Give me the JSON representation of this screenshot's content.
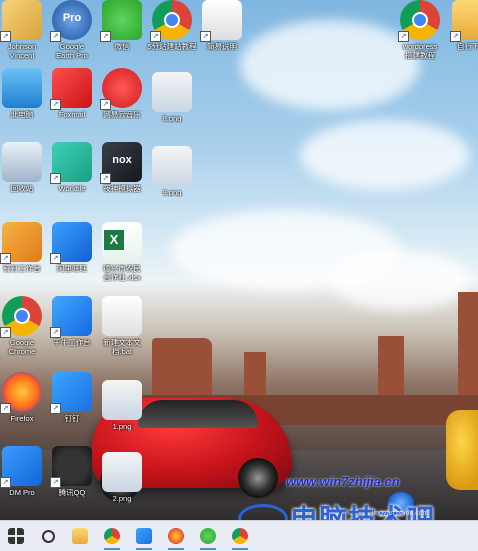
{
  "desktop": {
    "icons": [
      {
        "id": "johnson",
        "label": "Johnson\nVincent",
        "icon": "user-folder-icon"
      },
      {
        "id": "earth",
        "label": "Google\nEarth Pro",
        "icon": "google-earth-pro-icon",
        "badge": "Pro"
      },
      {
        "id": "wechat",
        "label": "微信",
        "icon": "wechat-icon"
      },
      {
        "id": "chrome-tutorial",
        "label": "5分站建站教程",
        "icon": "chrome-icon"
      },
      {
        "id": "doc1",
        "label": "简易说明",
        "icon": "document-icon"
      },
      {
        "id": "wordpress",
        "label": "wordpress\n搭建教程",
        "icon": "chrome-icon"
      },
      {
        "id": "rightfolder",
        "label": "自行下载",
        "icon": "folder-icon"
      },
      {
        "id": "thispc",
        "label": "此电脑",
        "icon": "computer-icon"
      },
      {
        "id": "foxmail",
        "label": "Foxmail",
        "icon": "foxmail-icon"
      },
      {
        "id": "netease",
        "label": "网易云音乐",
        "icon": "netease-music-icon"
      },
      {
        "id": "png8",
        "label": "8.png",
        "icon": "image-file-icon"
      },
      {
        "id": "recycle",
        "label": "回收站",
        "icon": "recycle-bin-icon"
      },
      {
        "id": "worktile",
        "label": "Worktile",
        "icon": "worktile-icon"
      },
      {
        "id": "nox",
        "label": "夜神模拟器",
        "icon": "nox-icon",
        "badge": "nox"
      },
      {
        "id": "png9",
        "label": "9.png",
        "icon": "image-file-icon"
      },
      {
        "id": "qiandao",
        "label": "钉钉工作台",
        "icon": "archive-icon"
      },
      {
        "id": "alibaba",
        "label": "阿里旺旺",
        "icon": "alibaba-icon"
      },
      {
        "id": "excel",
        "label": "德兴市农民\n合作社.xlsx",
        "icon": "excel-icon"
      },
      {
        "id": "chrome2",
        "label": "Google\nChrome",
        "icon": "chrome-icon"
      },
      {
        "id": "qianniu",
        "label": "千牛工作台",
        "icon": "qianniu-icon"
      },
      {
        "id": "newtxt",
        "label": "新建文本文\n档.bat",
        "icon": "gear-file-icon"
      },
      {
        "id": "firefox",
        "label": "Firefox",
        "icon": "firefox-icon"
      },
      {
        "id": "dingtalk",
        "label": "钉钉",
        "icon": "dingtalk-icon"
      },
      {
        "id": "png1",
        "label": "1.png",
        "icon": "image-file-icon"
      },
      {
        "id": "dmpro",
        "label": "DM Pro",
        "icon": "mail-icon"
      },
      {
        "id": "qq",
        "label": "腾讯QQ",
        "icon": "qq-penguin-icon"
      },
      {
        "id": "png2",
        "label": "2.png",
        "icon": "image-file-icon"
      }
    ]
  },
  "watermark": {
    "url": "www.win7zhijia.cn",
    "brand": "电脑技术吧",
    "baidu": "jingyan.baidu.com"
  },
  "taskbar": {
    "items": [
      {
        "icon": "windows-start-icon"
      },
      {
        "icon": "search-icon"
      },
      {
        "icon": "file-explorer-icon"
      },
      {
        "icon": "chrome-icon"
      },
      {
        "icon": "dingtalk-icon"
      },
      {
        "icon": "firefox-icon"
      },
      {
        "icon": "wechat-icon"
      },
      {
        "icon": "chrome-icon"
      }
    ]
  }
}
